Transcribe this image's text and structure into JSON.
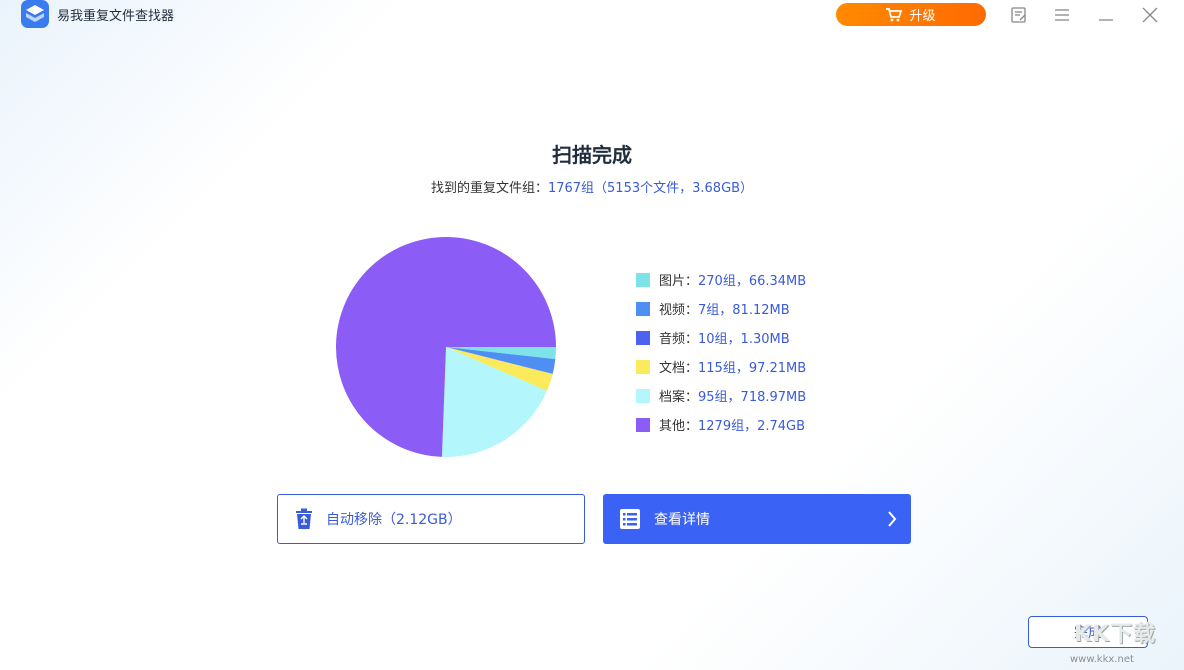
{
  "app": {
    "title": "易我重复文件查找器"
  },
  "titlebar": {
    "upgrade_label": "升级"
  },
  "scan": {
    "heading": "扫描完成",
    "summary_prefix": "找到的重复文件组：",
    "summary_value": "1767组（5153个文件，3.68GB）"
  },
  "chart_data": {
    "type": "pie",
    "categories": [
      "图片",
      "视频",
      "音频",
      "文档",
      "档案",
      "其他"
    ],
    "values": [
      66.34,
      81.12,
      1.3,
      97.21,
      718.97,
      2805.76
    ],
    "colors": [
      "#7de3e8",
      "#4f8ef2",
      "#4d63f0",
      "#fbea5c",
      "#b3f6fb",
      "#8b5cf6"
    ],
    "legend_position": "right"
  },
  "legend": [
    {
      "name": "图片：",
      "value": "270组，66.34MB",
      "color": "#7de3e8"
    },
    {
      "name": "视频：",
      "value": "7组，81.12MB",
      "color": "#4f8ef2"
    },
    {
      "name": "音频：",
      "value": "10组，1.30MB",
      "color": "#4d63f0"
    },
    {
      "name": "文档：",
      "value": "115组，97.21MB",
      "color": "#fbea5c"
    },
    {
      "name": "档案：",
      "value": "95组，718.97MB",
      "color": "#b3f6fb"
    },
    {
      "name": "其他：",
      "value": "1279组，2.74GB",
      "color": "#8b5cf6"
    }
  ],
  "actions": {
    "auto_remove_label": "自动移除（2.12GB）",
    "view_details_label": "查看详情"
  },
  "footer": {
    "done_label": "完成"
  },
  "watermark": {
    "big": "KK下载",
    "small": "www.kkx.net"
  },
  "icons": {
    "logo": "app-logo-icon",
    "cart": "cart-icon",
    "feedback": "feedback-icon",
    "menu": "menu-icon",
    "minimize": "minimize-icon",
    "close": "close-icon",
    "recycle": "recycle-bin-icon",
    "list": "list-icon",
    "chevron": "chevron-right-icon"
  }
}
